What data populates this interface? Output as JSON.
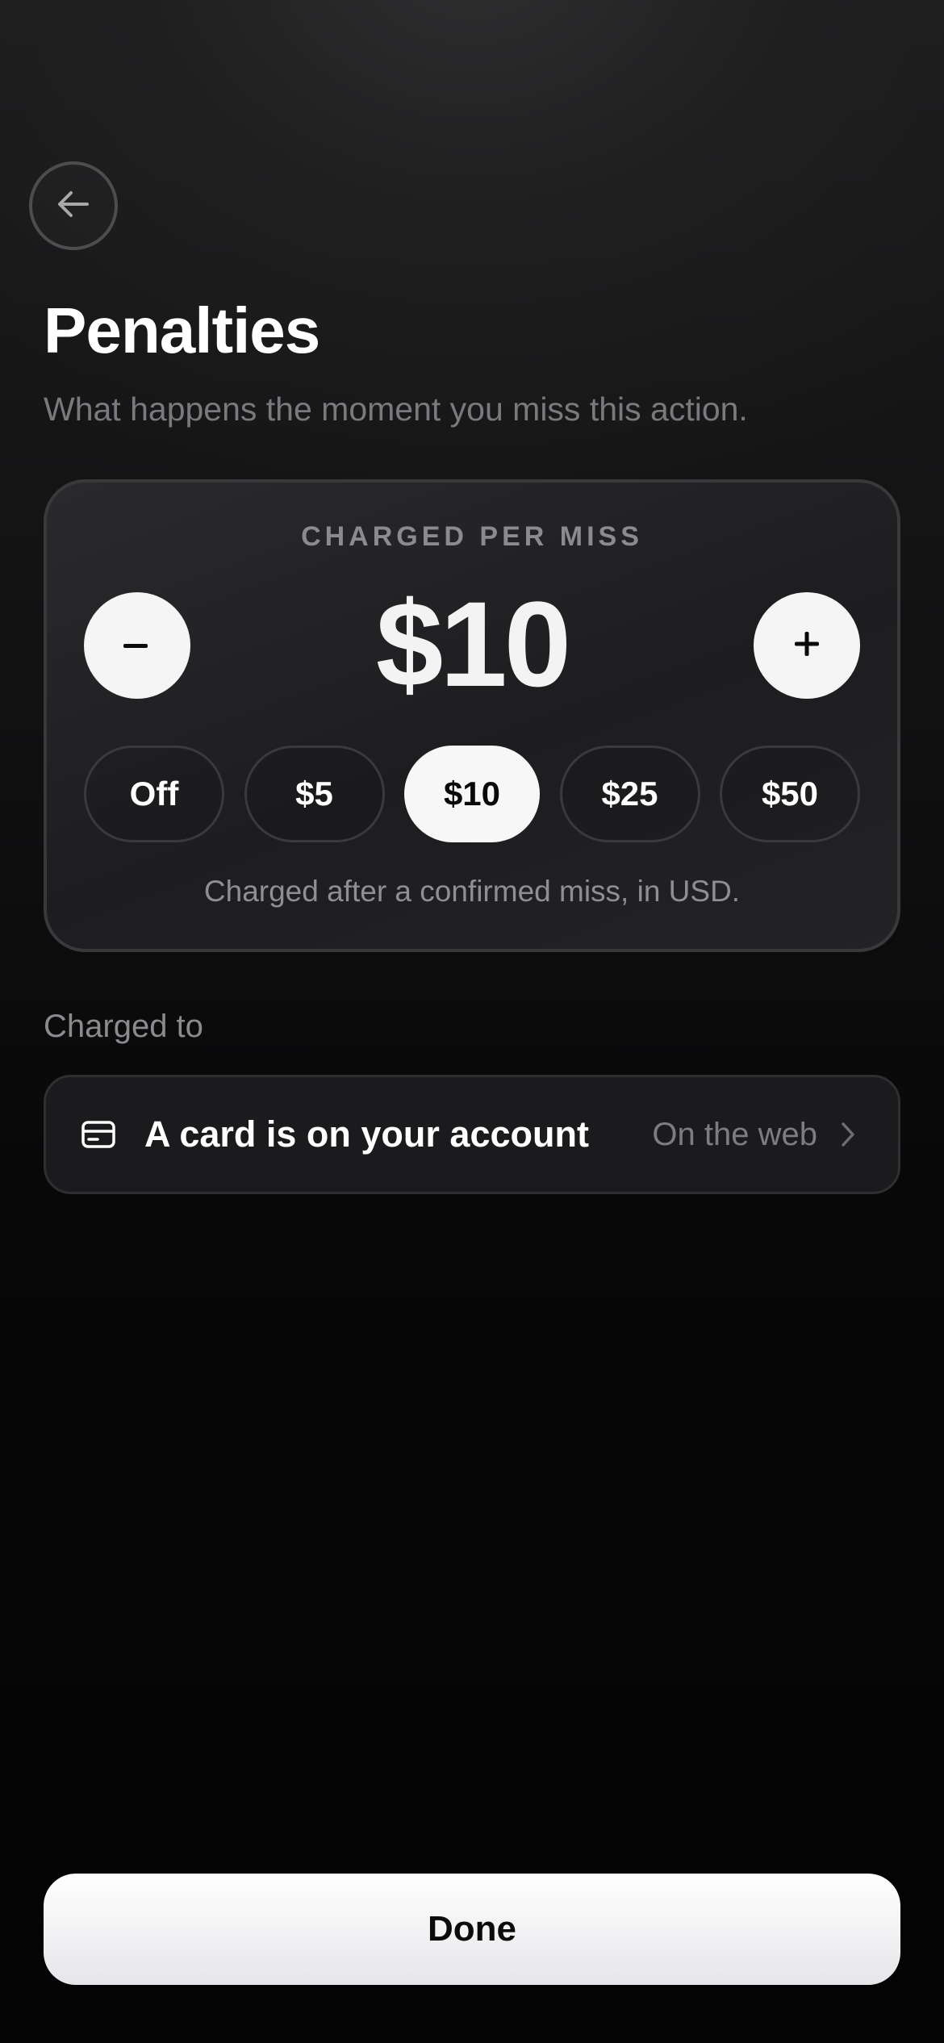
{
  "header": {
    "back_icon": "arrow-left-icon",
    "title": "Penalties",
    "subtitle": "What happens the moment you miss this action."
  },
  "penalty_card": {
    "label": "CHARGED PER MISS",
    "amount": "$10",
    "decrement_icon": "minus-icon",
    "increment_icon": "plus-icon",
    "presets": [
      {
        "label": "Off",
        "selected": false
      },
      {
        "label": "$5",
        "selected": false
      },
      {
        "label": "$10",
        "selected": true
      },
      {
        "label": "$25",
        "selected": false
      },
      {
        "label": "$50",
        "selected": false
      }
    ],
    "note": "Charged after a confirmed miss, in USD."
  },
  "charged_to": {
    "label": "Charged to",
    "card_icon": "credit-card-icon",
    "title": "A card is on your account",
    "hint": "On the web",
    "chevron_icon": "chevron-right-icon"
  },
  "footer": {
    "done_label": "Done"
  },
  "colors": {
    "background": "#0a0a0b",
    "accent": "#f5f5f5",
    "muted_text": "#8b8b8f",
    "card_border": "#39393c"
  }
}
